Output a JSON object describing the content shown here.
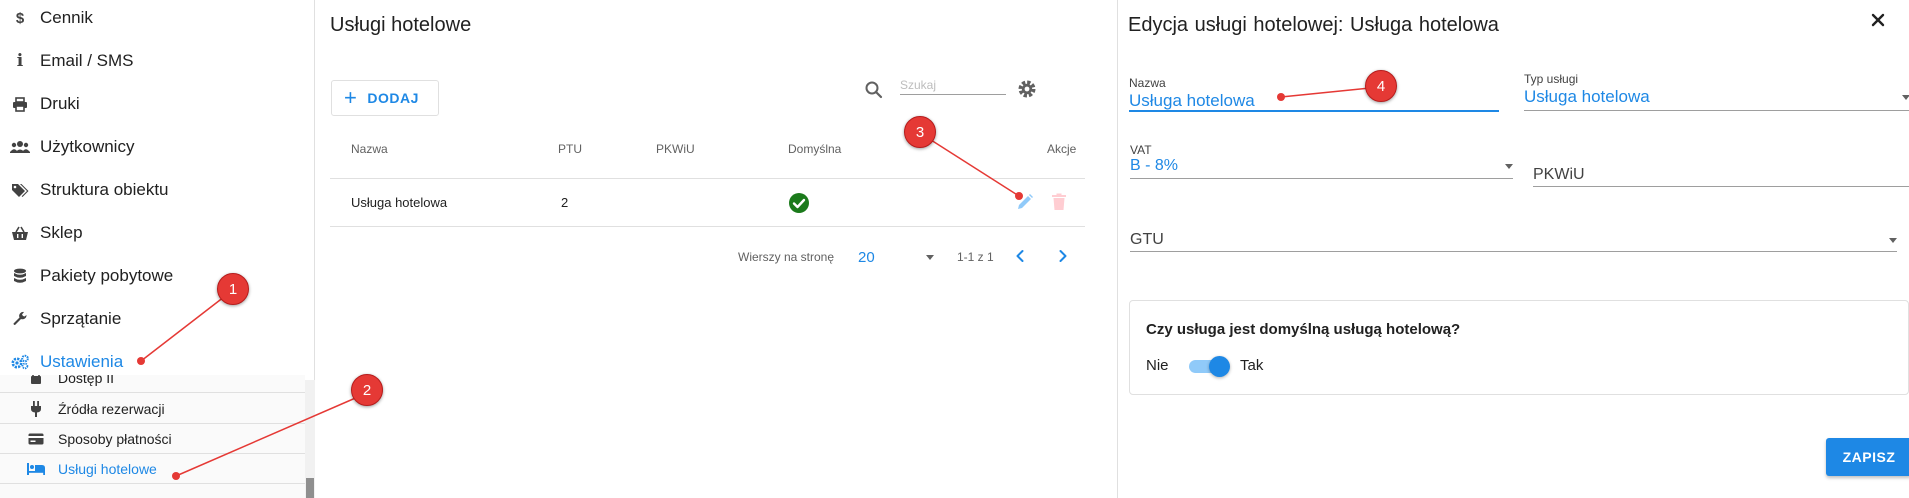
{
  "sidebar": {
    "items": [
      {
        "label": "Cennik",
        "icon": "dollar-icon"
      },
      {
        "label": "Email / SMS",
        "icon": "info-icon"
      },
      {
        "label": "Druki",
        "icon": "printer-icon"
      },
      {
        "label": "Użytkownicy",
        "icon": "users-icon"
      },
      {
        "label": "Struktura obiektu",
        "icon": "tags-icon"
      },
      {
        "label": "Sklep",
        "icon": "basket-icon"
      },
      {
        "label": "Pakiety pobytowe",
        "icon": "database-icon"
      },
      {
        "label": "Sprzątanie",
        "icon": "wrench-icon"
      },
      {
        "label": "Ustawienia",
        "icon": "cogs-icon",
        "active": true
      }
    ],
    "subitems": [
      {
        "label": "Dostęp II",
        "icon": "lock-icon"
      },
      {
        "label": "Źródła rezerwacji",
        "icon": "plug-icon"
      },
      {
        "label": "Sposoby płatności",
        "icon": "credit-card-icon"
      },
      {
        "label": "Usługi hotelowe",
        "icon": "bed-icon",
        "active": true
      }
    ]
  },
  "list": {
    "title": "Usługi hotelowe",
    "add_label": "DODAJ",
    "search_placeholder": "Szukaj",
    "columns": [
      "Nazwa",
      "PTU",
      "PKWiU",
      "Domyślna",
      "Akcje"
    ],
    "rows": [
      {
        "name": "Usługa hotelowa",
        "ptu": "2",
        "pkwiu": "",
        "default": true
      }
    ],
    "footer": {
      "rows_per_page_label": "Wierszy na stronę",
      "rows_per_page": "20",
      "range": "1-1 z 1"
    }
  },
  "edit": {
    "title_prefix": "Edycja usługi hotelowej:",
    "title_name": "Usługa hotelowa",
    "name_label": "Nazwa",
    "name_value": "Usługa hotelowa",
    "type_label": "Typ usługi",
    "type_value": "Usługa hotelowa",
    "vat_label": "VAT",
    "vat_value": "B - 8%",
    "pkwiu_label": "PKWiU",
    "gtu_label": "GTU",
    "default_question": "Czy usługa jest domyślną usługą hotelową?",
    "toggle_off": "Nie",
    "toggle_on": "Tak",
    "default_on": true,
    "save_label": "ZAPISZ"
  },
  "annotations": [
    "1",
    "2",
    "3",
    "4"
  ],
  "colors": {
    "accent": "#1e88e5",
    "success": "#1b7a1b",
    "danger": "#e53935"
  }
}
